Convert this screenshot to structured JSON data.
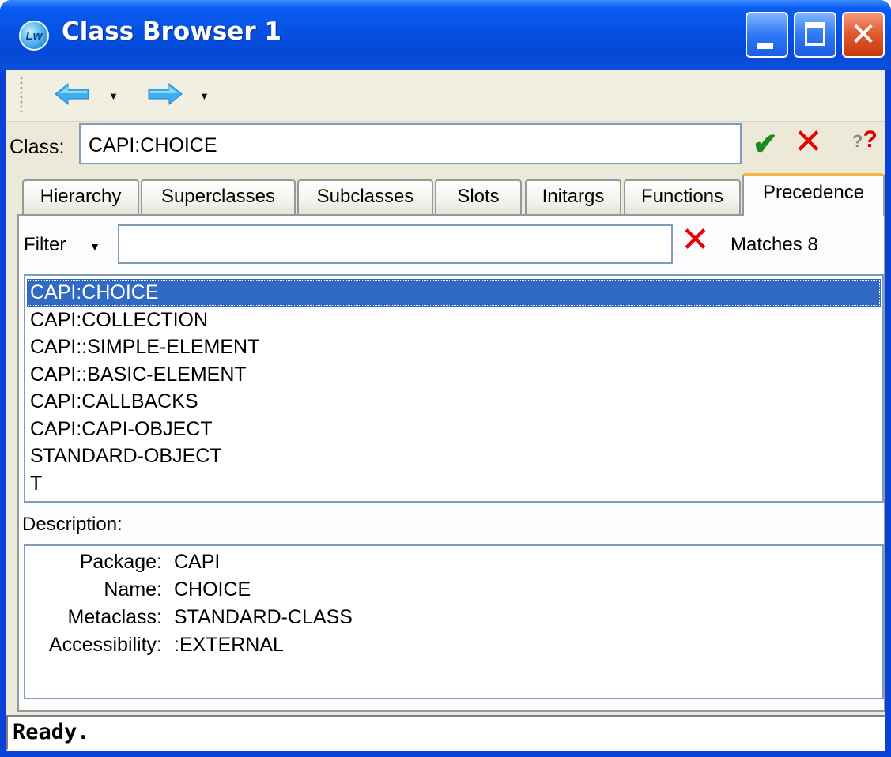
{
  "window": {
    "title": "Class Browser 1",
    "icon_text": "Lw",
    "controls": [
      "minimize-icon",
      "maximize-icon",
      "close-icon"
    ]
  },
  "toolbar": {
    "back_icon": "back-arrow-icon",
    "forward_icon": "forward-arrow-icon"
  },
  "class_row": {
    "label": "Class:",
    "value": "CAPI:CHOICE",
    "ok_icon": "checkmark-icon",
    "cancel_icon": "red-x-icon",
    "help_icon": "help-icon"
  },
  "tabs": [
    {
      "label": "Hierarchy"
    },
    {
      "label": "Superclasses"
    },
    {
      "label": "Subclasses"
    },
    {
      "label": "Slots"
    },
    {
      "label": "Initargs"
    },
    {
      "label": "Functions"
    },
    {
      "label": "Precedence",
      "active": true
    }
  ],
  "filter": {
    "label": "Filter",
    "value": "",
    "matches": "Matches 8"
  },
  "precedence_list": {
    "items": [
      "CAPI:CHOICE",
      "CAPI:COLLECTION",
      "CAPI::SIMPLE-ELEMENT",
      "CAPI::BASIC-ELEMENT",
      "CAPI:CALLBACKS",
      "CAPI:CAPI-OBJECT",
      "STANDARD-OBJECT",
      "T"
    ],
    "selected": "CAPI:CHOICE"
  },
  "description": {
    "label": "Description:",
    "properties": [
      {
        "key": "Package:",
        "value": "CAPI"
      },
      {
        "key": "Name:",
        "value": "CHOICE"
      },
      {
        "key": "Metaclass:",
        "value": "STANDARD-CLASS"
      },
      {
        "key": "Accessibility:",
        "value": ":EXTERNAL"
      }
    ]
  },
  "status": "Ready.",
  "colors": {
    "title_bar": "#0651e4",
    "selection": "#316ac5",
    "active_tab_accent": "#f7b83d",
    "cancel_red": "#e60000",
    "ok_green": "#1d8a1d"
  }
}
